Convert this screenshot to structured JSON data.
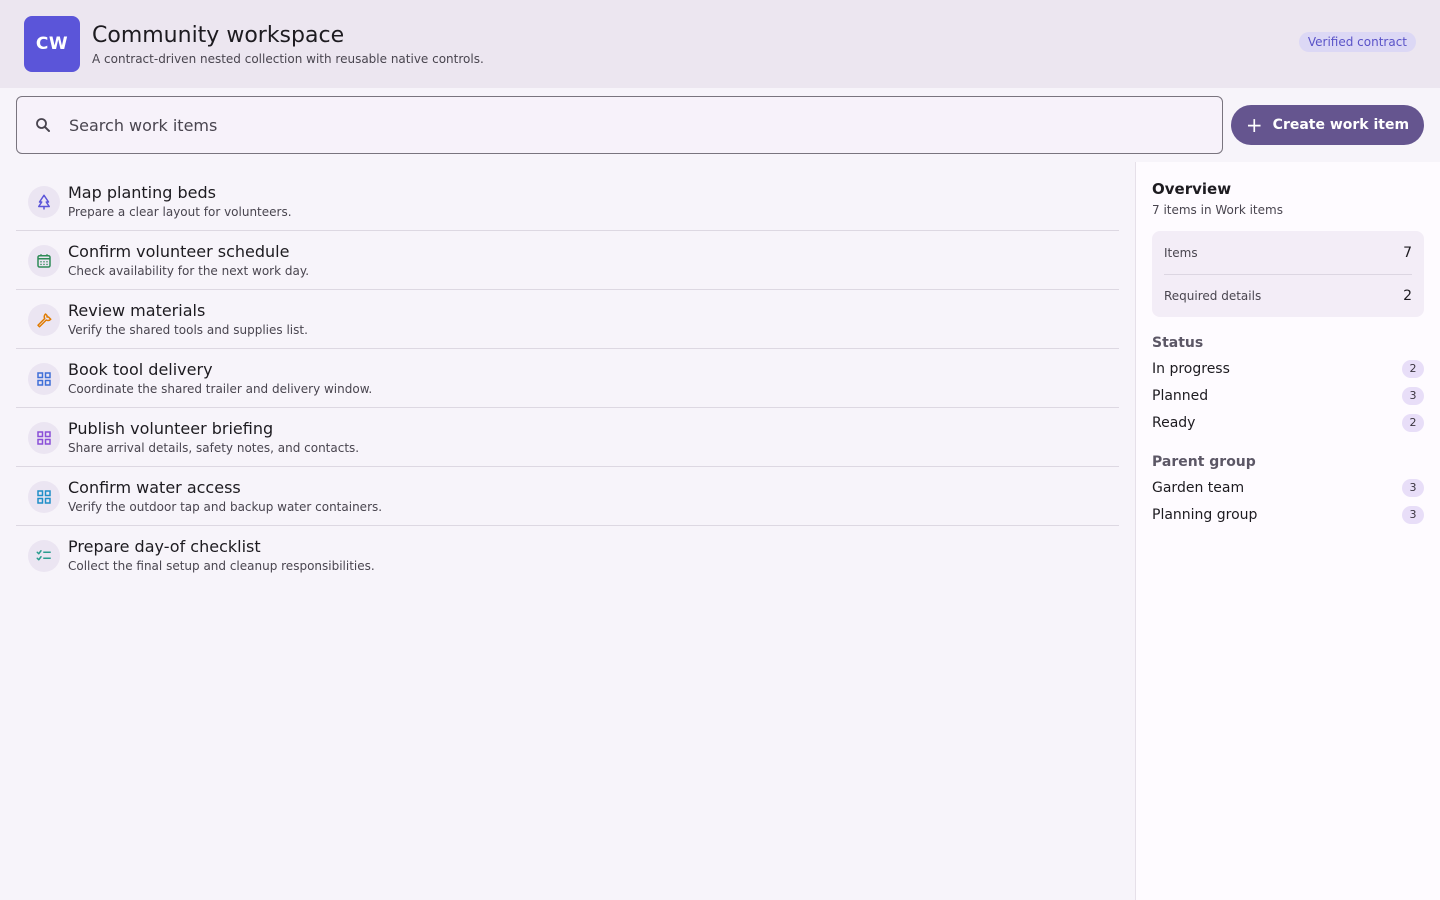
{
  "header": {
    "logo_text": "CW",
    "title": "Community workspace",
    "subtitle": "A contract-driven nested collection with reusable native controls.",
    "badge": "Verified contract"
  },
  "search": {
    "placeholder": "Search work items",
    "value": ""
  },
  "toolbar": {
    "create_label": "Create work item",
    "create_icon": "plus-icon"
  },
  "items": [
    {
      "title": "Map planting beds",
      "description": "Prepare a clear layout for volunteers.",
      "icon": "tree-icon",
      "color": "#5b55d9"
    },
    {
      "title": "Confirm volunteer schedule",
      "description": "Check availability for the next work day.",
      "icon": "calendar-icon",
      "color": "#2e8b57"
    },
    {
      "title": "Review materials",
      "description": "Verify the shared tools and supplies list.",
      "icon": "wrench-icon",
      "color": "#e07b00"
    },
    {
      "title": "Book tool delivery",
      "description": "Coordinate the shared trailer and delivery window.",
      "icon": "grid-icon",
      "color": "#3f6fd8"
    },
    {
      "title": "Publish volunteer briefing",
      "description": "Share arrival details, safety notes, and contacts.",
      "icon": "grid-icon",
      "color": "#8a4fd8"
    },
    {
      "title": "Confirm water access",
      "description": "Verify the outdoor tap and backup water containers.",
      "icon": "grid-icon",
      "color": "#1f8fc8"
    },
    {
      "title": "Prepare day-of checklist",
      "description": "Collect the final setup and cleanup responsibilities.",
      "icon": "checklist-icon",
      "color": "#2a9d8f"
    }
  ],
  "overview": {
    "title": "Overview",
    "subtitle": "7 items in Work items",
    "stats": [
      {
        "label": "Items",
        "value": "7"
      },
      {
        "label": "Required details",
        "value": "2"
      }
    ],
    "status_title": "Status",
    "status": [
      {
        "label": "In progress",
        "count": "2"
      },
      {
        "label": "Planned",
        "count": "3"
      },
      {
        "label": "Ready",
        "count": "2"
      }
    ],
    "parent_title": "Parent group",
    "parents": [
      {
        "label": "Garden team",
        "count": "3"
      },
      {
        "label": "Planning group",
        "count": "3"
      }
    ]
  }
}
